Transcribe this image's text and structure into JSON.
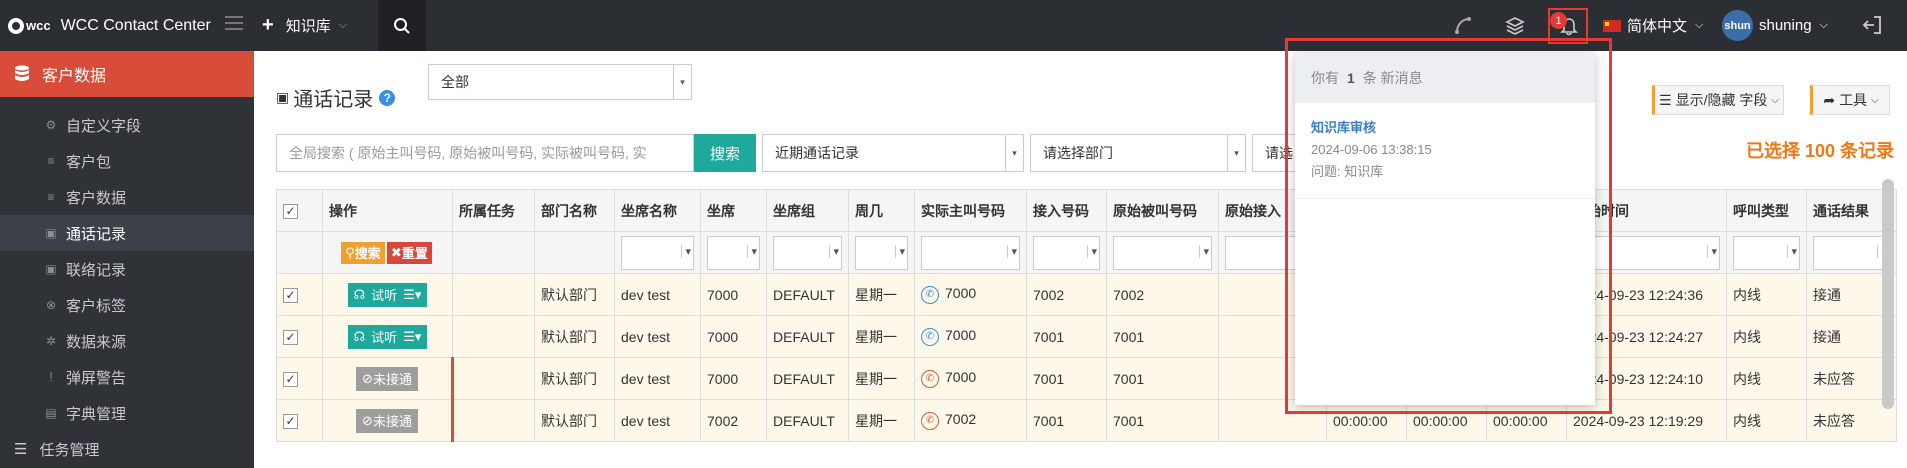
{
  "app": {
    "title": "WCC Contact Center",
    "logo_text": "wcc"
  },
  "topbar": {
    "knowledge_base": "知识库",
    "notification_count": "1",
    "language": "简体中文",
    "user_initials": "shun",
    "user_name": "shuning",
    "icons": [
      "menu-icon",
      "plus-icon",
      "search-icon",
      "phone-icon",
      "layers-icon",
      "bell-icon",
      "logout-icon"
    ]
  },
  "sidebar": {
    "header": "客户数据",
    "items": [
      {
        "label": "自定义字段",
        "icon": "gear-icon"
      },
      {
        "label": "客户包",
        "icon": "database-icon"
      },
      {
        "label": "客户数据",
        "icon": "database-icon"
      },
      {
        "label": "通话记录",
        "icon": "lock-icon",
        "active": true
      },
      {
        "label": "联络记录",
        "icon": "lock-icon"
      },
      {
        "label": "客户标签",
        "icon": "tag-icon"
      },
      {
        "label": "数据来源",
        "icon": "gears-icon"
      },
      {
        "label": "弹屏警告",
        "icon": "exclamation-icon"
      },
      {
        "label": "字典管理",
        "icon": "book-icon"
      }
    ],
    "next_group": "任务管理"
  },
  "main": {
    "title": "通话记录",
    "help": "?",
    "scope_select": "全部",
    "search_placeholder": "全局搜索 ( 原始主叫号码, 原始被叫号码, 实际被叫号码, 实",
    "search_button": "搜索",
    "recent_select": "近期通话记录",
    "dept_select": "请选择部门",
    "other_select": "请选",
    "show_hide_button": "显示/隐藏 字段",
    "tools_button": "工具",
    "selected_count": "已选择 100 条记录"
  },
  "table": {
    "headers": [
      "操作",
      "所属任务",
      "部门名称",
      "坐席名称",
      "坐席",
      "坐席组",
      "周几",
      "实际主叫号码",
      "接入号码",
      "原始被叫号码",
      "原始接入",
      "",
      "",
      "",
      "开始时间",
      "呼叫类型",
      "通话结果"
    ],
    "filter_search": "搜索",
    "filter_reset": "重置",
    "rows": [
      {
        "action": "试听",
        "task": "",
        "dept": "默认部门",
        "agent_name": "dev test",
        "agent": "7000",
        "group": "DEFAULT",
        "weekday": "星期一",
        "caller": "7000",
        "access": "7002",
        "orig_called": "7002",
        "c11": "",
        "c12": "",
        "c13": "",
        "start": "2024-09-23 12:24:36",
        "type": "内线",
        "result": "接通",
        "answered": true
      },
      {
        "action": "试听",
        "task": "",
        "dept": "默认部门",
        "agent_name": "dev test",
        "agent": "7000",
        "group": "DEFAULT",
        "weekday": "星期一",
        "caller": "7000",
        "access": "7001",
        "orig_called": "7001",
        "c11": "",
        "c12": "",
        "c13": "",
        "start": "2024-09-23 12:24:27",
        "type": "内线",
        "result": "接通",
        "answered": true
      },
      {
        "action": "未接通",
        "task": "",
        "dept": "默认部门",
        "agent_name": "dev test",
        "agent": "7000",
        "group": "DEFAULT",
        "weekday": "星期一",
        "caller": "7000",
        "access": "7001",
        "orig_called": "7001",
        "c11": "",
        "c12": "",
        "c13": "",
        "start": "2024-09-23 12:24:10",
        "type": "内线",
        "result": "未应答",
        "answered": false
      },
      {
        "action": "未接通",
        "task": "",
        "dept": "默认部门",
        "agent_name": "dev test",
        "agent": "7002",
        "group": "DEFAULT",
        "weekday": "星期一",
        "caller": "7002",
        "access": "7001",
        "orig_called": "7001",
        "c11": "00:00:00",
        "c12": "00:00:00",
        "c13": "00:00:00",
        "start": "2024-09-23 12:19:29",
        "type": "内线",
        "result": "未应答",
        "answered": false
      }
    ]
  },
  "notification": {
    "prefix": "你有",
    "count": "1",
    "suffix": "条 新消息",
    "items": [
      {
        "title": "知识库审核",
        "date": "2024-09-06 13:38:15",
        "topic": "问题: 知识库"
      }
    ]
  },
  "colors": {
    "accent_red": "#d94c39",
    "teal": "#1fa99c",
    "orange": "#f07814",
    "topbar": "#2b2e33"
  }
}
